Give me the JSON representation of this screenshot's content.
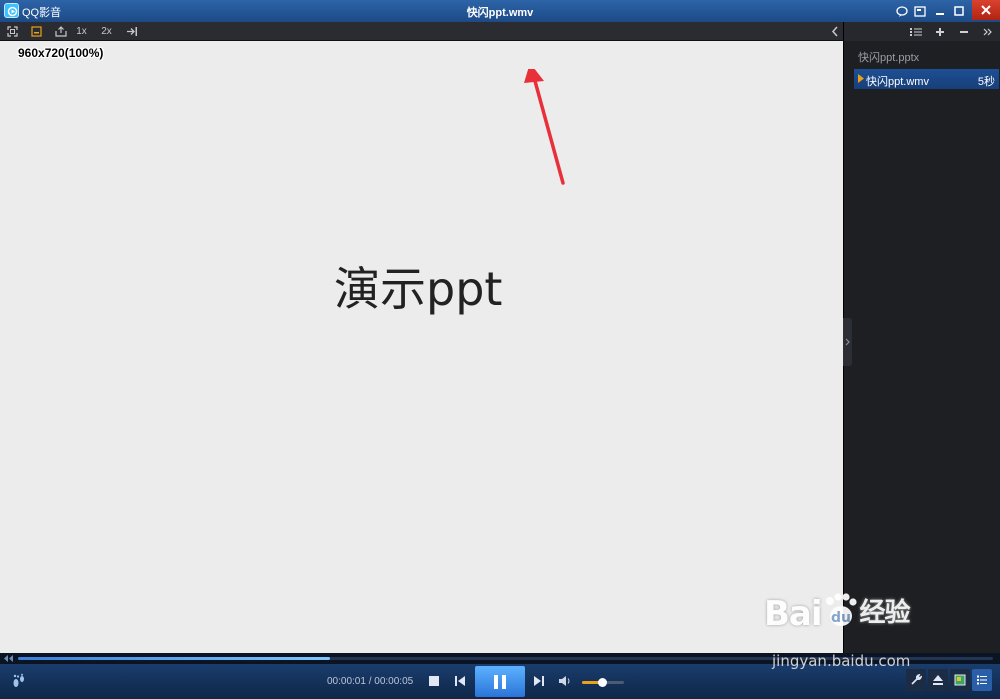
{
  "app": {
    "name": "QQ影音",
    "window_title": "快闪ppt.wmv"
  },
  "video_toolbar": {
    "speed_1x": "1x",
    "speed_2x": "2x"
  },
  "video": {
    "resolution": "960x720(100%)",
    "slide_text": "演示ppt"
  },
  "playlist": {
    "group": "快闪ppt.pptx",
    "items": [
      {
        "name": "快闪ppt.wmv",
        "duration": "5秒",
        "playing": true
      }
    ]
  },
  "playback": {
    "current_time": "00:00:01",
    "total_time": "00:00:05",
    "time_display": "00:00:01 / 00:00:05",
    "progress": 0.32,
    "volume": 0.47
  },
  "watermark": {
    "brand": "Bai",
    "brand2": "经验",
    "site": "jingyan.baidu.com"
  },
  "colors": {
    "title_bar": "#2d64a8",
    "accent": "#2a74d8",
    "annotation_arrow": "#e8303a",
    "volume": "#e8a21a"
  }
}
